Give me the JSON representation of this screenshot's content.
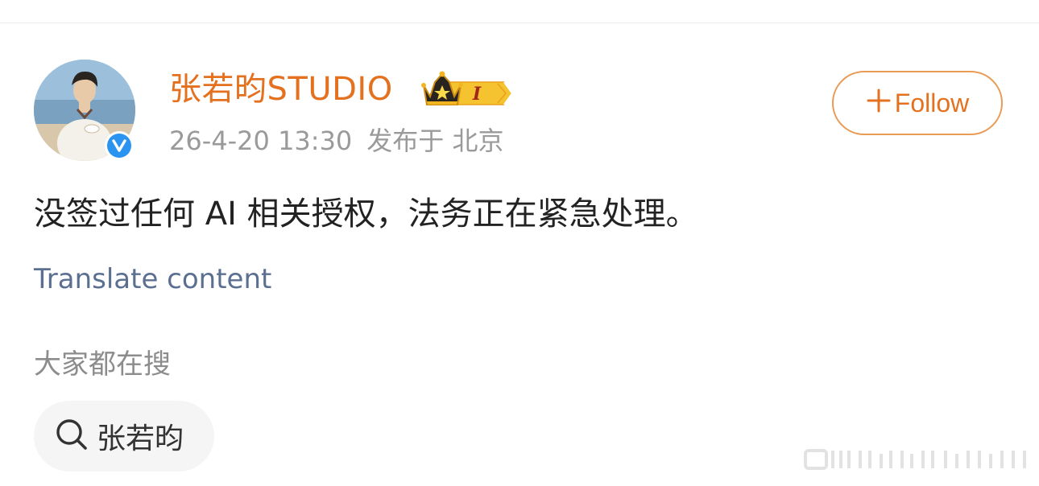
{
  "post": {
    "author": "张若昀STUDIO",
    "timestamp": "26-4-20 13:30",
    "location": "发布于 北京",
    "text": "没签过任何 AI 相关授权，法务正在紧急处理。",
    "translate_label": "Translate content"
  },
  "follow": {
    "label": "Follow"
  },
  "vip_badge": {
    "level": "I"
  },
  "search": {
    "heading": "大家都在搜",
    "chip_label": "张若昀"
  },
  "colors": {
    "accent": "#e4711f",
    "link": "#5b6f91",
    "verified": "#2b93f0"
  },
  "icons": [
    "verified-icon",
    "crown-icon",
    "plus-icon",
    "search-icon"
  ]
}
